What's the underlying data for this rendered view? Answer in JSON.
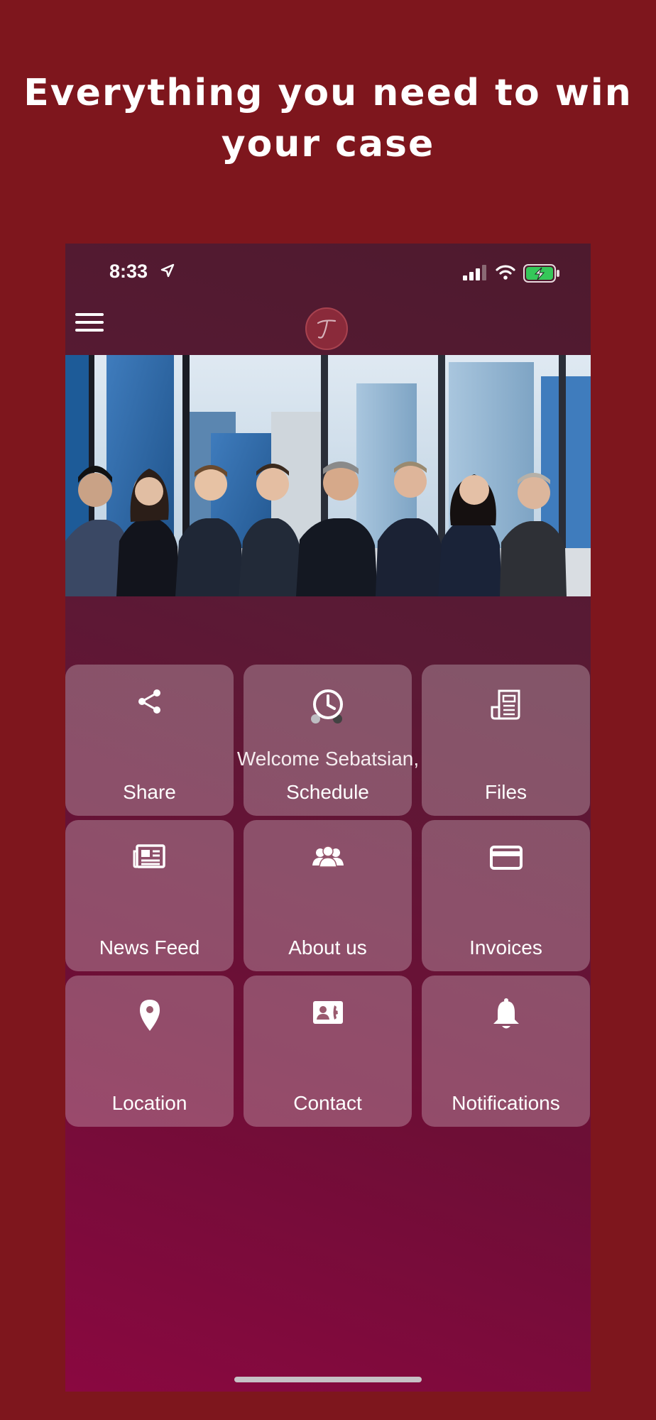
{
  "promo": {
    "title_line1": "Everything you need to win",
    "title_line2": "your case"
  },
  "status_bar": {
    "time": "8:33"
  },
  "nav": {
    "menu_icon": "hamburger-menu-icon",
    "logo_icon": "firm-logo"
  },
  "carousel": {
    "pages": 2,
    "active_page": 2
  },
  "welcome_text": "Welcome Sebatsian,",
  "menu": [
    {
      "label": "Share",
      "icon": "share-icon"
    },
    {
      "label": "Schedule",
      "icon": "clock-icon"
    },
    {
      "label": "Files",
      "icon": "document-icon"
    },
    {
      "label": "News Feed",
      "icon": "newspaper-icon"
    },
    {
      "label": "About us",
      "icon": "group-icon"
    },
    {
      "label": "Invoices",
      "icon": "credit-card-icon"
    },
    {
      "label": "Location",
      "icon": "map-pin-icon"
    },
    {
      "label": "Contact",
      "icon": "contact-card-icon"
    },
    {
      "label": "Notifications",
      "icon": "bell-icon"
    }
  ],
  "colors": {
    "background": "#7e161d",
    "tile": "rgba(255,255,255,0.26)",
    "battery_fill": "#35c759"
  }
}
